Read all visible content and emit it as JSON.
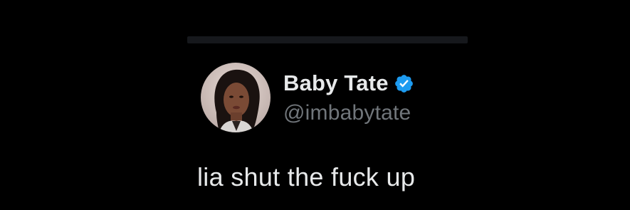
{
  "tweet": {
    "author": {
      "display_name": "Baby Tate",
      "handle": "@imbabytate",
      "verified": true,
      "avatar_icon": "profile-photo"
    },
    "text": "lia shut the fuck up"
  },
  "colors": {
    "background": "#000000",
    "primary_text": "#e7e9ea",
    "secondary_text": "#71767b",
    "verified_blue": "#1d9bf0",
    "divider": "#16181c"
  }
}
